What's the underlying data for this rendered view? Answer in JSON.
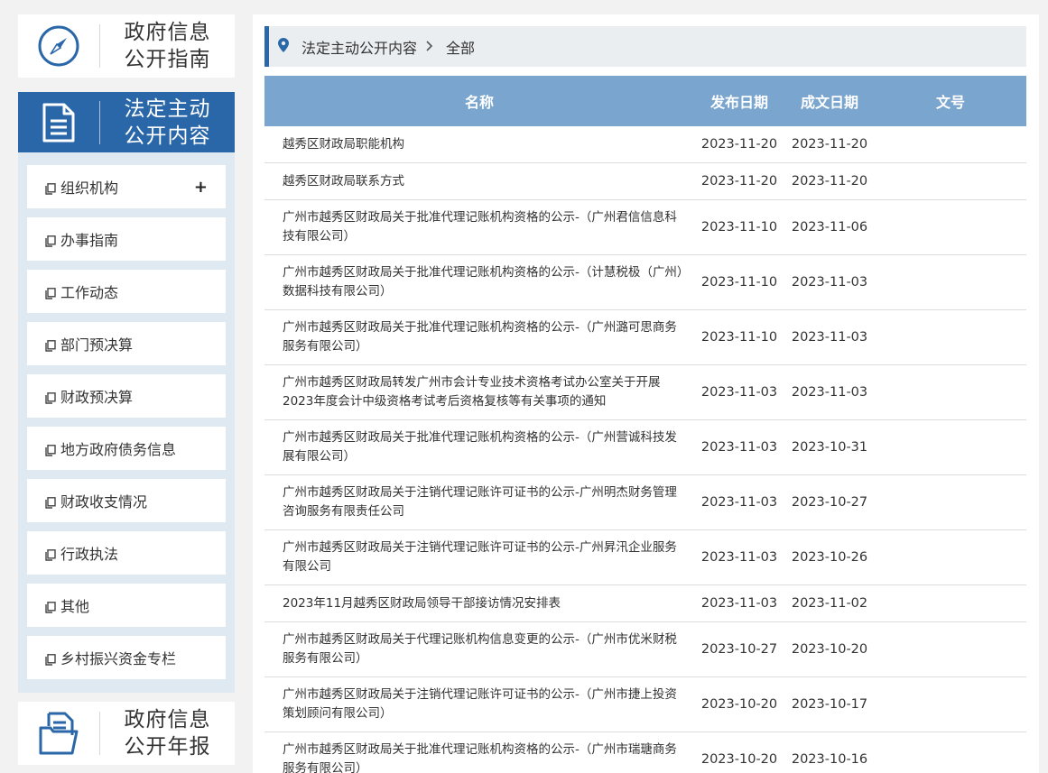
{
  "sidebar": {
    "guide": "政府信息\n公开指南",
    "active": "法定主动\n公开内容",
    "annual": "政府信息\n公开年报",
    "items": [
      {
        "label": "组织机构",
        "plus": "+"
      },
      {
        "label": "办事指南"
      },
      {
        "label": "工作动态"
      },
      {
        "label": "部门预决算"
      },
      {
        "label": "财政预决算"
      },
      {
        "label": "地方政府债务信息"
      },
      {
        "label": "财政收支情况"
      },
      {
        "label": "行政执法"
      },
      {
        "label": "其他"
      },
      {
        "label": "乡村振兴资金专栏"
      }
    ]
  },
  "breadcrumb": {
    "level1": "法定主动公开内容",
    "level2": "全部"
  },
  "table": {
    "headers": {
      "name": "名称",
      "pub_date": "发布日期",
      "doc_date": "成文日期",
      "doc_no": "文号"
    },
    "rows": [
      {
        "name": "越秀区财政局职能机构",
        "pub": "2023-11-20",
        "doc": "2023-11-20",
        "no": ""
      },
      {
        "name": "越秀区财政局联系方式",
        "pub": "2023-11-20",
        "doc": "2023-11-20",
        "no": ""
      },
      {
        "name": "广州市越秀区财政局关于批准代理记账机构资格的公示-（广州君信信息科技有限公司）",
        "pub": "2023-11-10",
        "doc": "2023-11-06",
        "no": ""
      },
      {
        "name": "广州市越秀区财政局关于批准代理记账机构资格的公示-（计慧税极（广州）数据科技有限公司）",
        "pub": "2023-11-10",
        "doc": "2023-11-03",
        "no": ""
      },
      {
        "name": "广州市越秀区财政局关于批准代理记账机构资格的公示-（广州潞可思商务服务有限公司）",
        "pub": "2023-11-10",
        "doc": "2023-11-03",
        "no": ""
      },
      {
        "name": "广州市越秀区财政局转发广州市会计专业技术资格考试办公室关于开展2023年度会计中级资格考试考后资格复核等有关事项的通知",
        "pub": "2023-11-03",
        "doc": "2023-11-03",
        "no": ""
      },
      {
        "name": "广州市越秀区财政局关于批准代理记账机构资格的公示-（广州营诚科技发展有限公司）",
        "pub": "2023-11-03",
        "doc": "2023-10-31",
        "no": ""
      },
      {
        "name": "广州市越秀区财政局关于注销代理记账许可证书的公示-广州明杰财务管理咨询服务有限责任公司",
        "pub": "2023-11-03",
        "doc": "2023-10-27",
        "no": ""
      },
      {
        "name": "广州市越秀区财政局关于注销代理记账许可证书的公示-广州昇汛企业服务有限公司",
        "pub": "2023-11-03",
        "doc": "2023-10-26",
        "no": ""
      },
      {
        "name": "2023年11月越秀区财政局领导干部接访情况安排表",
        "pub": "2023-11-03",
        "doc": "2023-11-02",
        "no": ""
      },
      {
        "name": "广州市越秀区财政局关于代理记账机构信息变更的公示-（广州市优米财税服务有限公司）",
        "pub": "2023-10-27",
        "doc": "2023-10-20",
        "no": ""
      },
      {
        "name": "广州市越秀区财政局关于注销代理记账许可证书的公示-（广州市捷上投资策划顾问有限公司）",
        "pub": "2023-10-20",
        "doc": "2023-10-17",
        "no": ""
      },
      {
        "name": "广州市越秀区财政局关于批准代理记账机构资格的公示-（广州市瑞瑭商务服务有限公司）",
        "pub": "2023-10-20",
        "doc": "2023-10-16",
        "no": ""
      }
    ]
  },
  "colors": {
    "primary": "#2a67a8",
    "table_header": "#79a5cf",
    "menu_bg": "#dfe9f2"
  }
}
